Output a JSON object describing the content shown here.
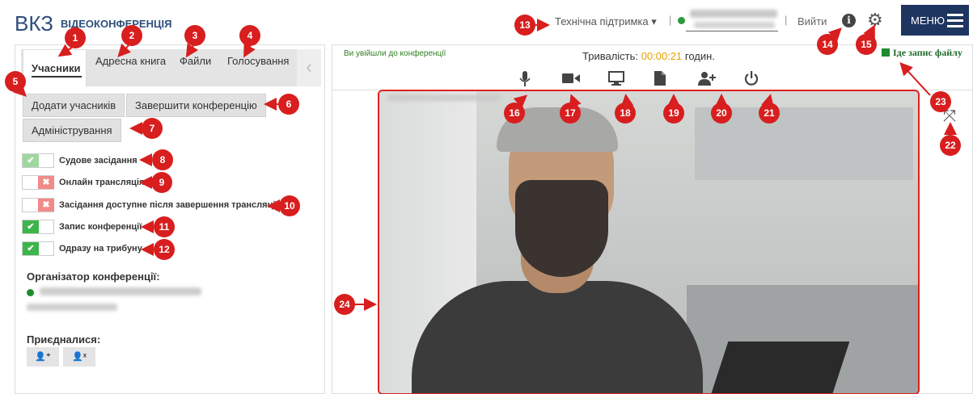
{
  "header": {
    "logo": "ВКЗ",
    "logo_sub": "ВІДЕОКОНФЕРЕНЦІЯ",
    "support": "Технічна підтримка ▾",
    "sep1": "|",
    "sep2": "|",
    "logout": "Вийти",
    "info_glyph": "i",
    "menu": "МЕНЮ"
  },
  "tabs": [
    "Учасники",
    "Адресна книга",
    "Файли",
    "Голосування"
  ],
  "buttons": {
    "add": "Додати учасників",
    "finish": "Завершити конференцію",
    "admin": "Адміністрування"
  },
  "toggles": [
    {
      "label": "Судове засідання",
      "state": "on-light"
    },
    {
      "label": "Онлайн трансляція",
      "state": "off"
    },
    {
      "label": "Засідання доступне після завершення трансляції",
      "state": "off"
    },
    {
      "label": "Запис конференції",
      "state": "on"
    },
    {
      "label": "Одразу на трибуну",
      "state": "on"
    }
  ],
  "organizer_heading": "Організатор конференції:",
  "joined_heading": "Приєдналися:",
  "status": {
    "entered": "Ви увійшли до конференції",
    "duration_label": "Тривалість:",
    "duration_value": "00:00:21",
    "duration_unit": "годин.",
    "recording": "Іде запис файлу"
  },
  "toolbar_icons": [
    "microphone-icon",
    "camera-icon",
    "screen-share-icon",
    "document-icon",
    "add-user-icon",
    "power-icon"
  ],
  "callouts": [
    "1",
    "2",
    "3",
    "4",
    "5",
    "6",
    "7",
    "8",
    "9",
    "10",
    "11",
    "12",
    "13",
    "14",
    "15",
    "16",
    "17",
    "18",
    "19",
    "20",
    "21",
    "22",
    "23",
    "24"
  ],
  "colors": {
    "accent": "#1e3560",
    "callout": "#d81e1e",
    "rec": "#1e8b2e",
    "on": "#3cb64a",
    "off": "#f28a8a"
  }
}
